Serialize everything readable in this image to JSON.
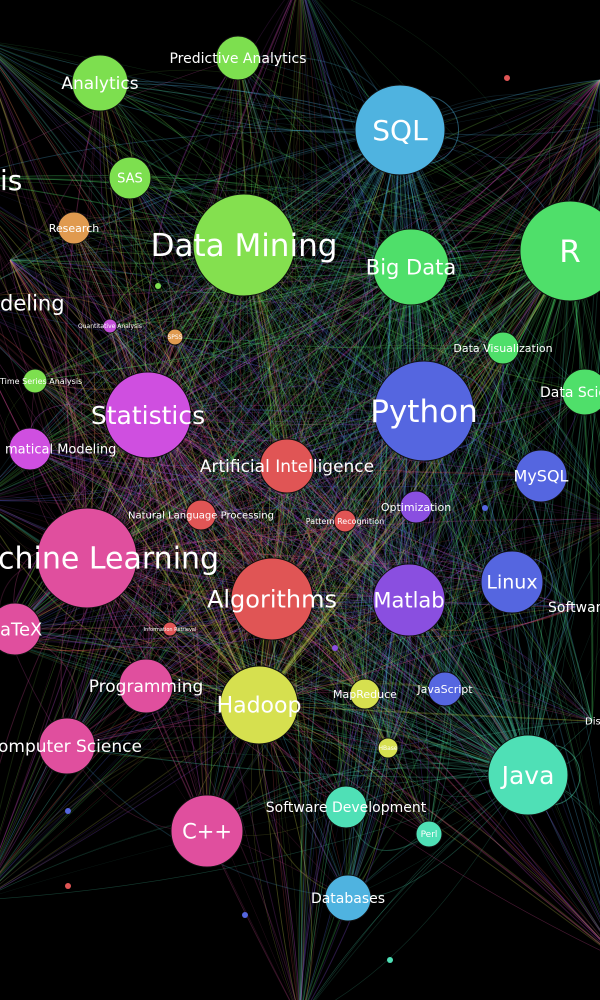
{
  "graph": {
    "background": "#000000",
    "nodes": [
      {
        "id": "analysis",
        "label": "is",
        "color": "#d94fb0",
        "size": 0,
        "cluster": "pink"
      },
      {
        "id": "predictive-analytics",
        "label": "Predictive Analytics",
        "color": "#7ddf4f",
        "size": 2,
        "cluster": "green"
      },
      {
        "id": "analytics",
        "label": "Analytics",
        "color": "#7ddf4f",
        "size": 3,
        "cluster": "green"
      },
      {
        "id": "sql",
        "label": "SQL",
        "color": "#4fb3e0",
        "size": 5,
        "cluster": "blue"
      },
      {
        "id": "sas",
        "label": "SAS",
        "color": "#7ddf4f",
        "size": 2,
        "cluster": "green"
      },
      {
        "id": "research",
        "label": "Research",
        "color": "#e09a4f",
        "size": 2,
        "cluster": "orange"
      },
      {
        "id": "data-mining",
        "label": "Data Mining",
        "color": "#84e04f",
        "size": 6,
        "cluster": "green"
      },
      {
        "id": "big-data",
        "label": "Big Data",
        "color": "#4fdf6a",
        "size": 4,
        "cluster": "green"
      },
      {
        "id": "r",
        "label": "R",
        "color": "#4fdf6a",
        "size": 6,
        "cluster": "green"
      },
      {
        "id": "modeling",
        "label": "deling",
        "color": "#d94fb0",
        "size": 0,
        "cluster": "pink"
      },
      {
        "id": "quant-analysis",
        "label": "Quantitative Analysis",
        "color": "#c44fd9",
        "size": 1,
        "cluster": "purple"
      },
      {
        "id": "spss",
        "label": "SPSS",
        "color": "#e09a4f",
        "size": 1,
        "cluster": "orange"
      },
      {
        "id": "data-visualization",
        "label": "Data Visualization",
        "color": "#4fdf6a",
        "size": 2,
        "cluster": "green"
      },
      {
        "id": "time-series",
        "label": "Time Series Analysis",
        "color": "#7ddf4f",
        "size": 1,
        "cluster": "green"
      },
      {
        "id": "statistics",
        "label": "Statistics",
        "color": "#cf4fe0",
        "size": 5,
        "cluster": "purple"
      },
      {
        "id": "python",
        "label": "Python",
        "color": "#5566e0",
        "size": 6,
        "cluster": "blue"
      },
      {
        "id": "data-science",
        "label": "Data Scie",
        "color": "#4fdf6a",
        "size": 3,
        "cluster": "green"
      },
      {
        "id": "math-modeling",
        "label": "matical Modeling",
        "color": "#cf4fe0",
        "size": 2,
        "cluster": "purple"
      },
      {
        "id": "ai",
        "label": "Artificial Intelligence",
        "color": "#e05555",
        "size": 3,
        "cluster": "red"
      },
      {
        "id": "mysql",
        "label": "MySQL",
        "color": "#5566e0",
        "size": 3,
        "cluster": "blue"
      },
      {
        "id": "nlp",
        "label": "Natural Language Processing",
        "color": "#e05555",
        "size": 2,
        "cluster": "red"
      },
      {
        "id": "pattern-recognition",
        "label": "Pattern Recognition",
        "color": "#e05555",
        "size": 1,
        "cluster": "red"
      },
      {
        "id": "optimization",
        "label": "Optimization",
        "color": "#8a4fe0",
        "size": 2,
        "cluster": "violet"
      },
      {
        "id": "machine-learning",
        "label": "chine Learning",
        "color": "#e04f9e",
        "size": 6,
        "cluster": "pink"
      },
      {
        "id": "algorithms",
        "label": "Algorithms",
        "color": "#e05555",
        "size": 5,
        "cluster": "red"
      },
      {
        "id": "matlab",
        "label": "Matlab",
        "color": "#8a4fe0",
        "size": 4,
        "cluster": "violet"
      },
      {
        "id": "linux",
        "label": "Linux",
        "color": "#5566e0",
        "size": 3,
        "cluster": "blue"
      },
      {
        "id": "software",
        "label": "Softwar",
        "color": "#5566e0",
        "size": 0,
        "cluster": "blue"
      },
      {
        "id": "latex",
        "label": "aTeX",
        "color": "#e04f9e",
        "size": 3,
        "cluster": "pink"
      },
      {
        "id": "programming",
        "label": "Programming",
        "color": "#e04f9e",
        "size": 3,
        "cluster": "pink"
      },
      {
        "id": "hadoop",
        "label": "Hadoop",
        "color": "#d6e04f",
        "size": 4,
        "cluster": "yellow"
      },
      {
        "id": "mapreduce",
        "label": "MapReduce",
        "color": "#d6e04f",
        "size": 2,
        "cluster": "yellow"
      },
      {
        "id": "javascript",
        "label": "JavaScript",
        "color": "#5566e0",
        "size": 2,
        "cluster": "blue"
      },
      {
        "id": "distributed",
        "label": "Dis",
        "color": "#4fe0b6",
        "size": 0,
        "cluster": "teal"
      },
      {
        "id": "computer-science",
        "label": "omputer Science",
        "color": "#e04f9e",
        "size": 3,
        "cluster": "pink"
      },
      {
        "id": "hbase",
        "label": "HBase",
        "color": "#d6e04f",
        "size": 1,
        "cluster": "yellow"
      },
      {
        "id": "java",
        "label": "Java",
        "color": "#4fe0b6",
        "size": 5,
        "cluster": "teal"
      },
      {
        "id": "cpp",
        "label": "C++",
        "color": "#e04f9e",
        "size": 4,
        "cluster": "pink"
      },
      {
        "id": "software-development",
        "label": "Software Development",
        "color": "#4fe0b6",
        "size": 2,
        "cluster": "teal"
      },
      {
        "id": "perl",
        "label": "Perl",
        "color": "#4fe0b6",
        "size": 2,
        "cluster": "teal"
      },
      {
        "id": "databases",
        "label": "Databases",
        "color": "#4fb3e0",
        "size": 2,
        "cluster": "blue"
      },
      {
        "id": "information-retrieval",
        "label": "Information Retrieval",
        "color": "#e05555",
        "size": 1,
        "cluster": "red"
      }
    ]
  }
}
